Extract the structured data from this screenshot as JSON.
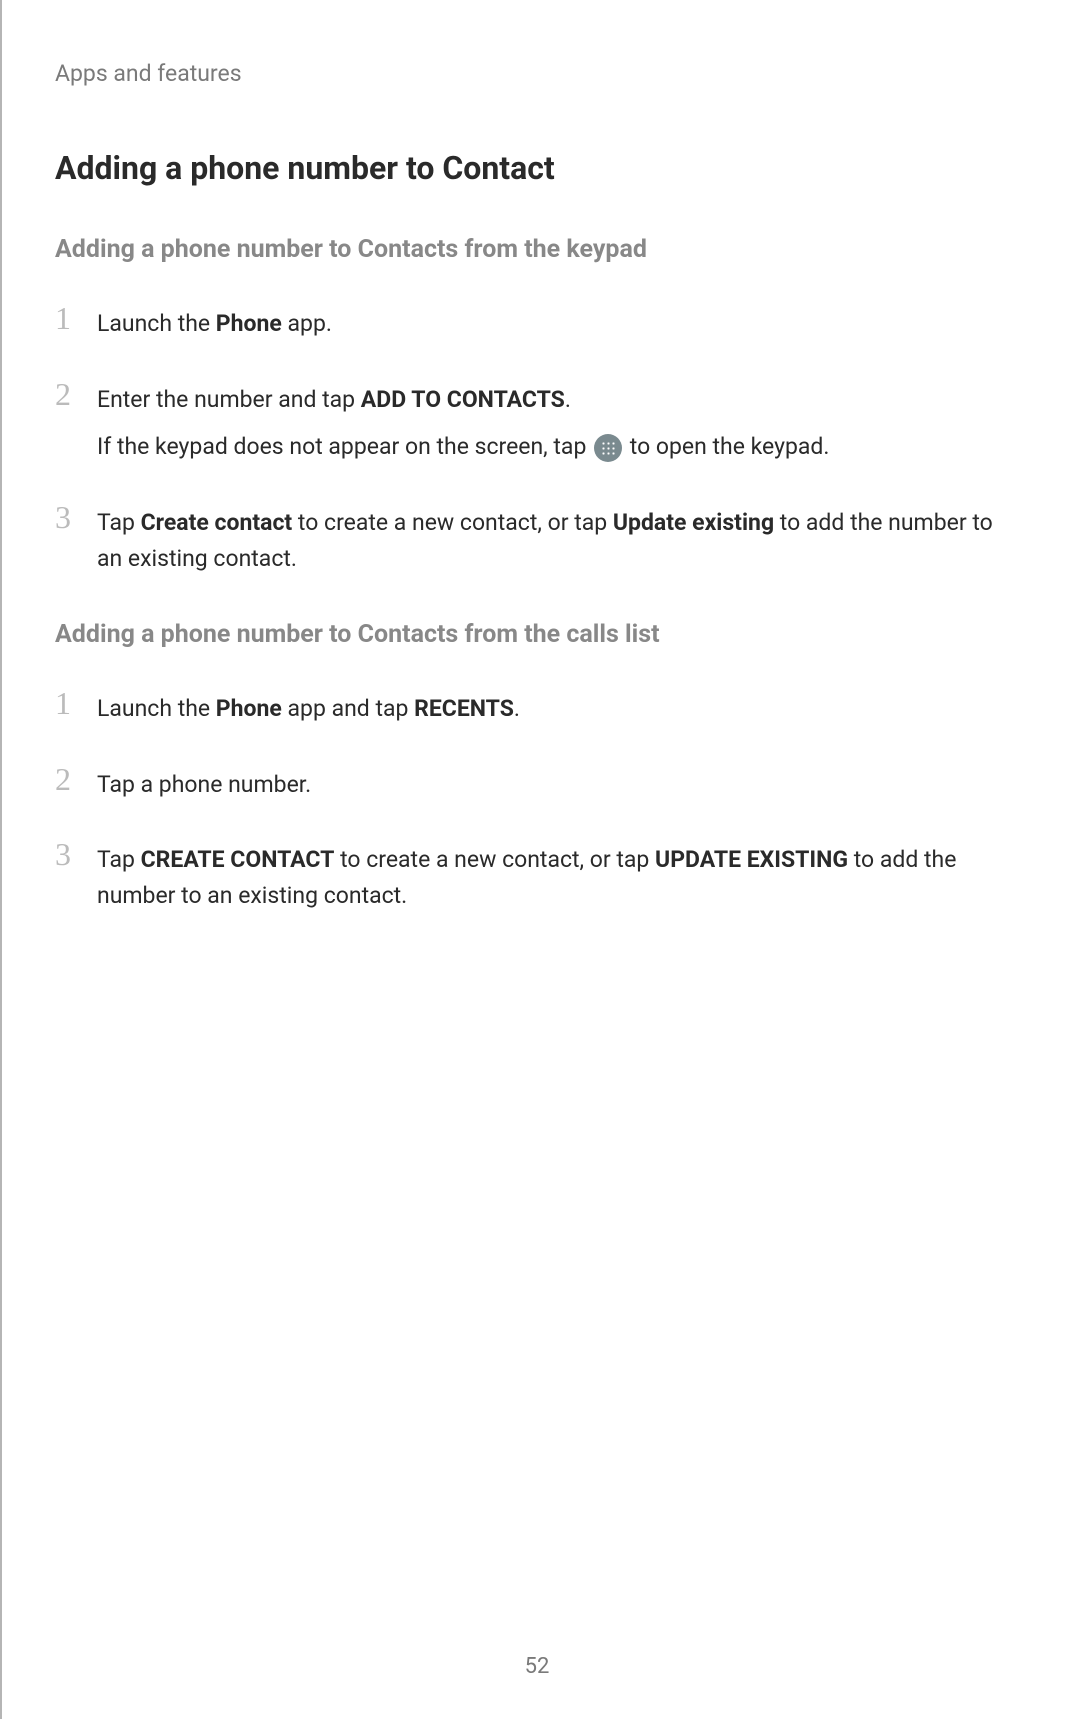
{
  "header": {
    "section": "Apps and features"
  },
  "heading": "Adding a phone number to Contact",
  "section1": {
    "title": "Adding a phone number to Contacts from the keypad",
    "steps": [
      {
        "num": "1",
        "parts": [
          {
            "text": "Launch the ",
            "bold": false
          },
          {
            "text": "Phone",
            "bold": true
          },
          {
            "text": " app.",
            "bold": false
          }
        ]
      },
      {
        "num": "2",
        "parts": [
          {
            "text": "Enter the number and tap ",
            "bold": false
          },
          {
            "text": "ADD TO CONTACTS",
            "bold": true
          },
          {
            "text": ".",
            "bold": false
          }
        ],
        "sub_before": "If the keypad does not appear on the screen, tap ",
        "sub_after": " to open the keypad."
      },
      {
        "num": "3",
        "parts": [
          {
            "text": "Tap ",
            "bold": false
          },
          {
            "text": "Create contact",
            "bold": true
          },
          {
            "text": " to create a new contact, or tap ",
            "bold": false
          },
          {
            "text": "Update existing",
            "bold": true
          },
          {
            "text": " to add the number to an existing contact.",
            "bold": false
          }
        ]
      }
    ]
  },
  "section2": {
    "title": "Adding a phone number to Contacts from the calls list",
    "steps": [
      {
        "num": "1",
        "parts": [
          {
            "text": "Launch the ",
            "bold": false
          },
          {
            "text": "Phone",
            "bold": true
          },
          {
            "text": " app and tap ",
            "bold": false
          },
          {
            "text": "RECENTS",
            "bold": true
          },
          {
            "text": ".",
            "bold": false
          }
        ]
      },
      {
        "num": "2",
        "parts": [
          {
            "text": "Tap a phone number.",
            "bold": false
          }
        ]
      },
      {
        "num": "3",
        "parts": [
          {
            "text": "Tap ",
            "bold": false
          },
          {
            "text": "CREATE CONTACT",
            "bold": true
          },
          {
            "text": " to create a new contact, or tap ",
            "bold": false
          },
          {
            "text": "UPDATE EXISTING",
            "bold": true
          },
          {
            "text": " to add the number to an existing contact.",
            "bold": false
          }
        ]
      }
    ]
  },
  "page_number": "52"
}
